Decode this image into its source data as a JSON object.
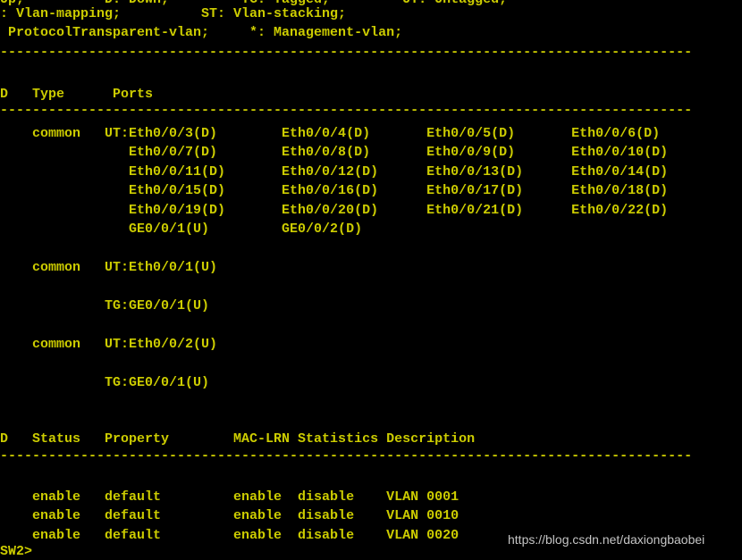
{
  "terminal": {
    "colors": {
      "background": "#000000",
      "foreground": "#cccc00",
      "watermark": "#d6d6d6"
    },
    "legend": {
      "line1": "Up;          D: Down;         TG: Tagged;         UT: Untagged;",
      "line2": ": Vlan-mapping;          ST: Vlan-stacking;",
      "line3": " ProtocolTransparent-vlan;     *: Management-vlan;"
    },
    "rule1": "--------------------------------------------------------------------------------------",
    "rule2": "--------------------------------------------------------------------------------------",
    "rule3": "--------------------------------------------------------------------------------------",
    "rule4": "--------------------------------------------------------------------------------------",
    "ports_table": {
      "header": "D   Type      Ports",
      "rows": [
        "    common   UT:Eth0/0/3(D)        Eth0/0/4(D)       Eth0/0/5(D)       Eth0/0/6(D)",
        "                Eth0/0/7(D)        Eth0/0/8(D)       Eth0/0/9(D)       Eth0/0/10(D)",
        "                Eth0/0/11(D)       Eth0/0/12(D)      Eth0/0/13(D)      Eth0/0/14(D)",
        "                Eth0/0/15(D)       Eth0/0/16(D)      Eth0/0/17(D)      Eth0/0/18(D)",
        "                Eth0/0/19(D)       Eth0/0/20(D)      Eth0/0/21(D)      Eth0/0/22(D)",
        "                GE0/0/1(U)         GE0/0/2(D)",
        "",
        "    common   UT:Eth0/0/1(U)",
        "",
        "             TG:GE0/0/1(U)",
        "",
        "    common   UT:Eth0/0/2(U)",
        "",
        "             TG:GE0/0/1(U)"
      ]
    },
    "status_table": {
      "header": "D   Status   Property        MAC-LRN Statistics Description",
      "rows": [
        "    enable   default         enable  disable    VLAN 0001",
        "    enable   default         enable  disable    VLAN 0010",
        "    enable   default         enable  disable    VLAN 0020"
      ]
    },
    "prompt": "SW2>",
    "watermark": "https://blog.csdn.net/daxiongbaobei"
  }
}
